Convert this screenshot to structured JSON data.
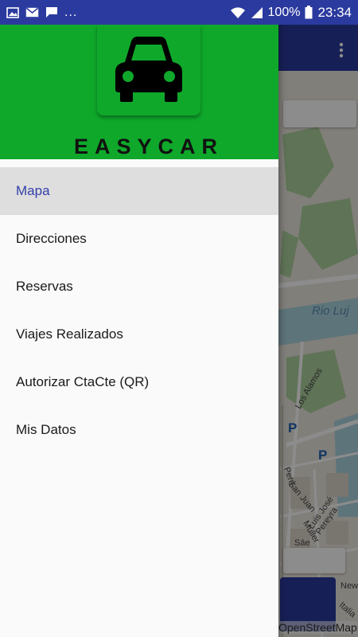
{
  "status_bar": {
    "icons_left": [
      "image-icon",
      "mail-icon",
      "chat-icon"
    ],
    "overflow_dots": "...",
    "battery": "100%",
    "time": "23:34"
  },
  "drawer": {
    "brand": "EASYCAR",
    "items": [
      {
        "label": "Mapa",
        "active": true
      },
      {
        "label": "Direcciones"
      },
      {
        "label": "Reservas"
      },
      {
        "label": "Viajes Realizados"
      },
      {
        "label": "Autorizar CtaCte (QR)"
      },
      {
        "label": "Mis Datos"
      }
    ]
  },
  "map": {
    "river_label": "Rio Luj",
    "street_labels": [
      "Los Alamos",
      "Perú",
      "San Juan",
      "Luis José Pereyra",
      "Muller",
      "Sáe",
      "New",
      "Italia"
    ],
    "parking_symbol": "P",
    "attribution": "OpenStreetMap"
  },
  "colors": {
    "primary": "#2b3a9e",
    "header_green": "#0fa82b",
    "active_text": "#3440a8"
  }
}
